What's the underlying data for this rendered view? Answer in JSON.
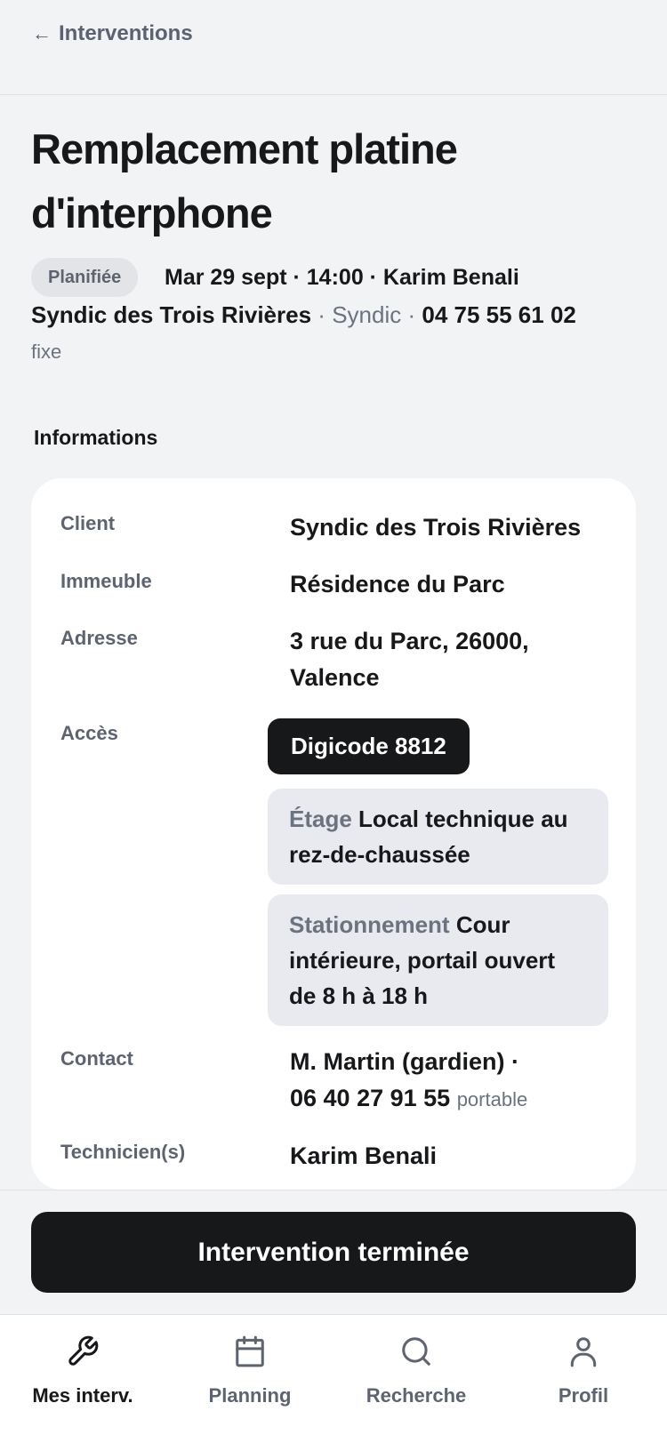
{
  "header": {
    "back_arrow": "←",
    "back_label": "Interventions"
  },
  "intervention": {
    "title": "Remplacement platine d'interphone",
    "status": "Planifiée",
    "meta": "Mar 29 sept · 14:00 · Karim Benali",
    "client_name": "Syndic des Trois Rivières",
    "separator": "·",
    "client_role": "Syndic",
    "phone": "04 75 55 61 02",
    "phone_type": "fixe"
  },
  "info": {
    "section_title": "Informations",
    "client_label": "Client",
    "client_value": "Syndic des Trois Rivières",
    "building_label": "Immeuble",
    "building_value": "Résidence du Parc",
    "address_label": "Adresse",
    "address_value": "3 rue du Parc, 26000, Valence",
    "access_label": "Accès",
    "digicode": "Digicode 8812",
    "floor_key": "Étage",
    "floor_value": "Local technique au rez-de-chaussée",
    "parking_key": "Stationnement",
    "parking_value": "Cour intérieure, portail ouvert de 8 h à 18 h",
    "contact_label": "Contact",
    "contact_name": "M. Martin (gardien) ·",
    "contact_phone": "06 40 27 91 55",
    "contact_phone_type": "portable",
    "tech_label": "Technicien(s)",
    "tech_value": "Karim Benali"
  },
  "actions": {
    "complete_label": "Intervention terminée"
  },
  "tabs": [
    {
      "label": "Mes interv.",
      "icon": "wrench-icon",
      "active": true
    },
    {
      "label": "Planning",
      "icon": "calendar-icon",
      "active": false
    },
    {
      "label": "Recherche",
      "icon": "search-icon",
      "active": false
    },
    {
      "label": "Profil",
      "icon": "user-icon",
      "active": false
    }
  ],
  "colors": {
    "accent": "#17181a",
    "background": "#f2f3f5",
    "muted": "#5e6370"
  }
}
